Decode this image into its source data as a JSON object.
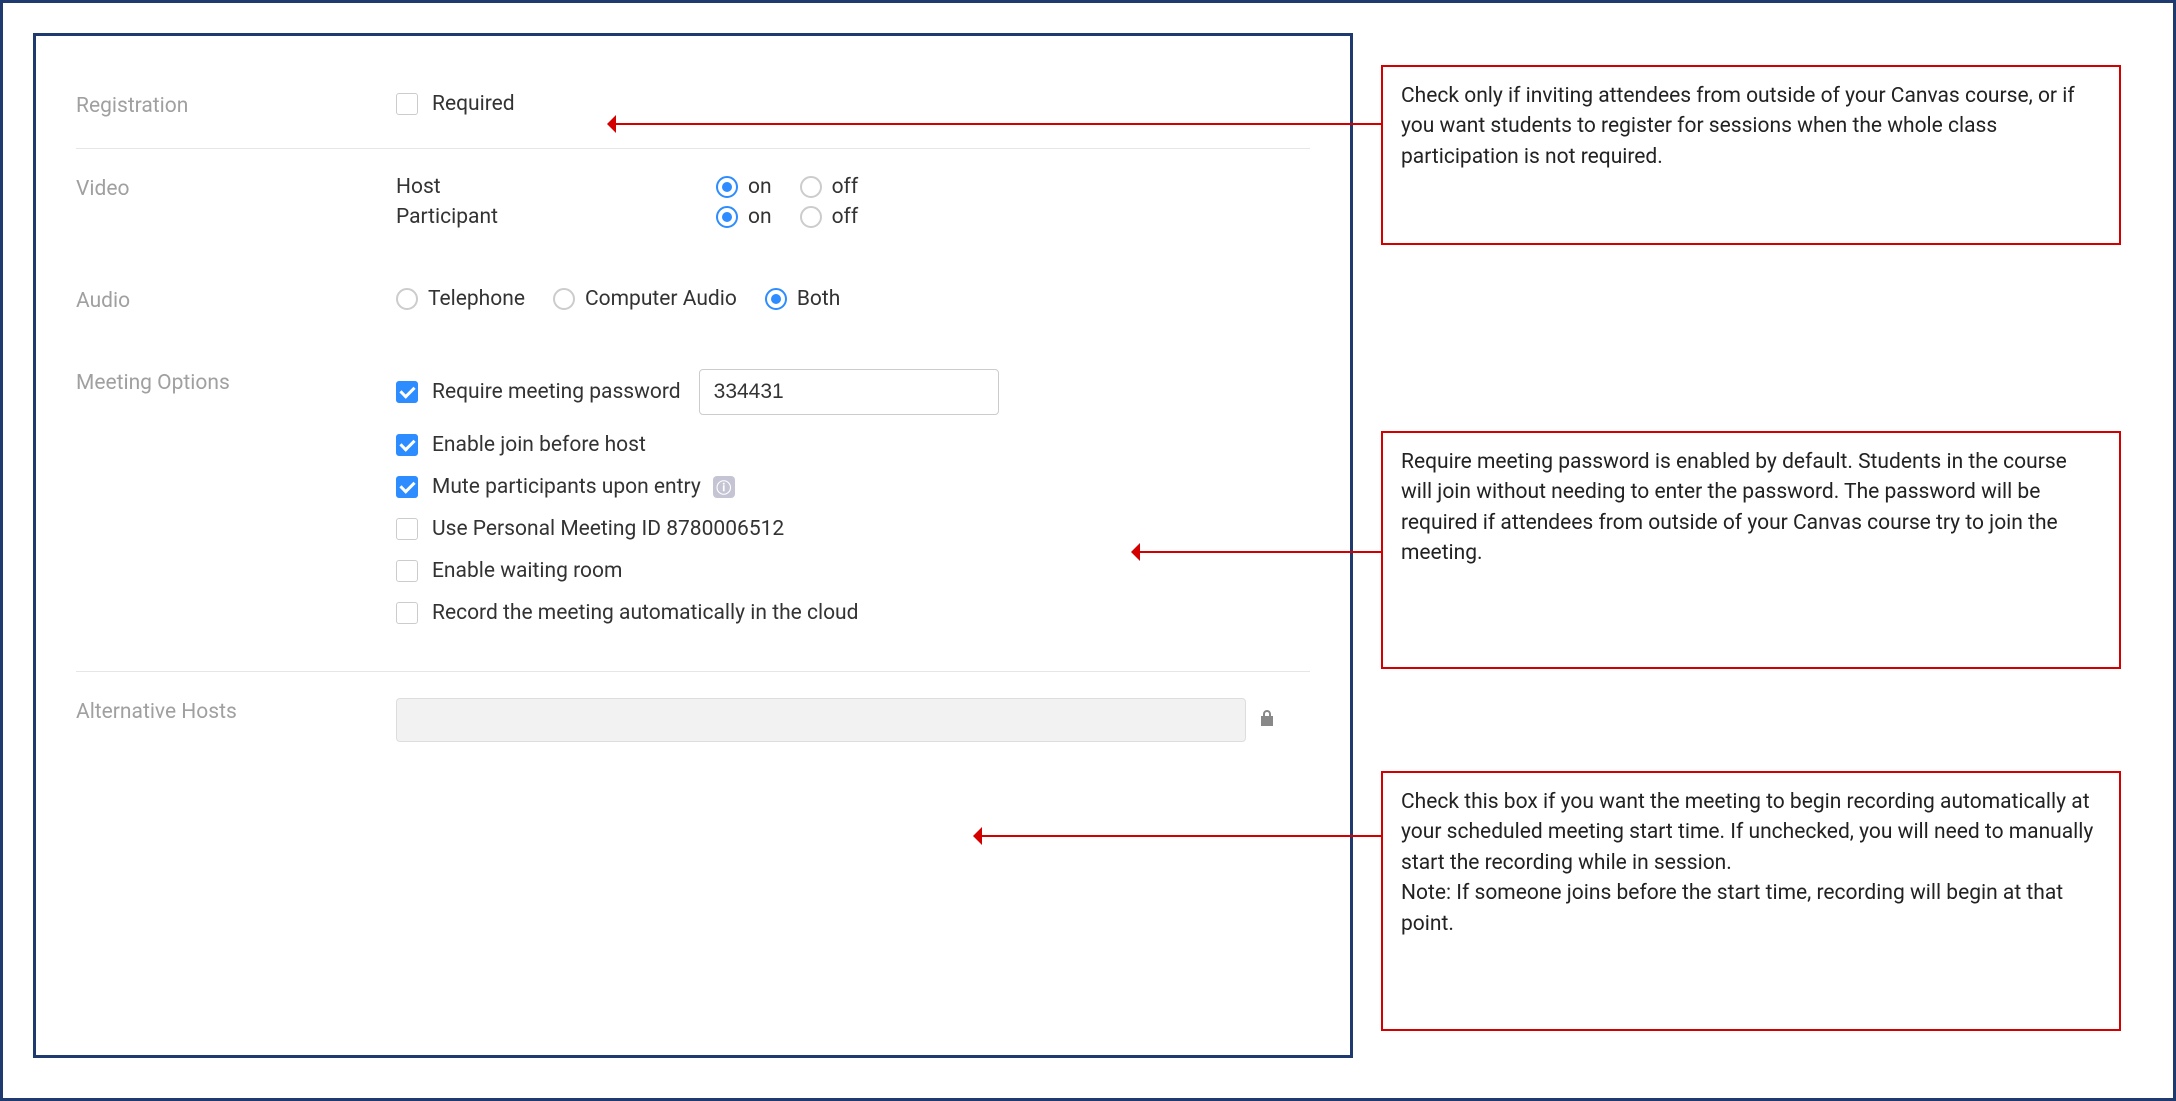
{
  "sections": {
    "registration": {
      "label": "Registration",
      "required_label": "Required"
    },
    "video": {
      "label": "Video",
      "host_label": "Host",
      "participant_label": "Participant",
      "on": "on",
      "off": "off"
    },
    "audio": {
      "label": "Audio",
      "telephone": "Telephone",
      "computer": "Computer Audio",
      "both": "Both"
    },
    "meeting_options": {
      "label": "Meeting Options",
      "require_password": "Require meeting password",
      "password_value": "334431",
      "join_before_host": "Enable join before host",
      "mute_entry": "Mute participants upon entry",
      "use_pmi": "Use Personal Meeting ID 8780006512",
      "waiting_room": "Enable waiting room",
      "auto_record": "Record the meeting automatically in the cloud"
    },
    "alternative_hosts": {
      "label": "Alternative Hosts"
    }
  },
  "callouts": {
    "c1": "Check only if inviting attendees from outside of your Canvas course, or if you want students to register for sessions when the whole class participation is not required.",
    "c2": "Require meeting password is enabled by default. Students in the course will join without needing to enter the password. The password will be required if attendees from outside of your Canvas course try to join the meeting.",
    "c3": "Check this box if you want the meeting to begin recording automatically at your scheduled meeting start time. If unchecked, you will need to manually start the recording while in session.\nNote: If someone joins before the start time, recording will begin at that point."
  }
}
